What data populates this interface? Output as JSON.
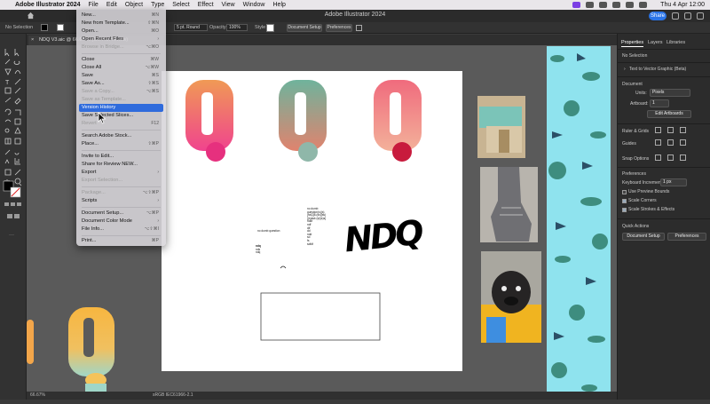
{
  "menubar": {
    "app_name": "Adobe Illustrator 2024",
    "menus": [
      "File",
      "Edit",
      "Object",
      "Type",
      "Select",
      "Effect",
      "View",
      "Window",
      "Help"
    ],
    "datetime": "Thu 4 Apr  12:00"
  },
  "titlebar": {
    "title": "Adobe Illustrator 2024",
    "share_label": "Share"
  },
  "control_bar": {
    "selection": "No Selection",
    "stroke_profile": "5 pt. Round",
    "opacity_label": "Opacity",
    "opacity_value": "100%",
    "style_label": "Style",
    "document_setup": "Document Setup",
    "preferences": "Preferences"
  },
  "document_tab": {
    "name": "NDQ V3.aic @ 66.67 % (CMYK/Preview)"
  },
  "file_menu": {
    "items": [
      {
        "label": "New...",
        "shortcut": "⌘N"
      },
      {
        "label": "New from Template...",
        "shortcut": "⇧⌘N"
      },
      {
        "label": "Open...",
        "shortcut": "⌘O"
      },
      {
        "label": "Open Recent Files",
        "shortcut": "›"
      },
      {
        "label": "Browse in Bridge...",
        "shortcut": "⌥⌘O"
      },
      {
        "label": "Close",
        "shortcut": "⌘W"
      },
      {
        "label": "Close All",
        "shortcut": "⌥⌘W"
      },
      {
        "label": "Save",
        "shortcut": "⌘S"
      },
      {
        "label": "Save As...",
        "shortcut": "⇧⌘S"
      },
      {
        "label": "Save a Copy...",
        "shortcut": "⌥⌘S"
      },
      {
        "label": "Save as Template...",
        "shortcut": ""
      },
      {
        "label": "Version History",
        "shortcut": ""
      },
      {
        "label": "Save Selected Slices...",
        "shortcut": ""
      },
      {
        "label": "Revert",
        "shortcut": "F12"
      },
      {
        "label": "Search Adobe Stock...",
        "shortcut": ""
      },
      {
        "label": "Place...",
        "shortcut": "⇧⌘P"
      },
      {
        "label": "Invite to Edit...",
        "shortcut": ""
      },
      {
        "label": "Share for Review NEW...",
        "shortcut": ""
      },
      {
        "label": "Export",
        "shortcut": "›"
      },
      {
        "label": "Export Selection...",
        "shortcut": ""
      },
      {
        "label": "Package...",
        "shortcut": "⌥⇧⌘P"
      },
      {
        "label": "Scripts",
        "shortcut": "›"
      },
      {
        "label": "Document Setup...",
        "shortcut": "⌥⌘P"
      },
      {
        "label": "Document Color Mode",
        "shortcut": "›"
      },
      {
        "label": "File Info...",
        "shortcut": "⌥⇧⌘I"
      },
      {
        "label": "Print...",
        "shortcut": "⌘P"
      }
    ]
  },
  "artwork": {
    "dumb_question": "no dumb question",
    "paragraph": [
      "no dumb",
      "question(s)(s)",
      "[ndQ]8.(ss)(ss)",
      "[(s)ask (s)i(s)s]",
      "nddf",
      "ndf",
      "dlf",
      "dd",
      "ndd",
      "sd",
      "fs",
      "sdfdf"
    ],
    "ndq_small": [
      "ndq",
      "nds",
      "ndq"
    ],
    "ndq_logo": "NDQ"
  },
  "properties_panel": {
    "tabs": [
      "Properties",
      "Layers",
      "Libraries"
    ],
    "no_selection": "No Selection",
    "text_to_vector": "Text to Vector Graphic (Beta)",
    "document_section": "Document",
    "units_label": "Units:",
    "units_value": "Pixels",
    "artboard_label": "Artboard:",
    "artboard_value": "1",
    "edit_artboards": "Edit Artboards",
    "rulers_grids": "Ruler & Grids",
    "guides": "Guides",
    "snap_options": "Snap Options",
    "preferences_section": "Preferences",
    "keyboard_increment_label": "Keyboard Increment:",
    "keyboard_increment_value": "1 px",
    "use_preview_bounds": "Use Preview Bounds",
    "scale_corners": "Scale Corners",
    "scale_strokes": "Scale Strokes & Effects",
    "quick_actions": "Quick Actions",
    "document_setup_btn": "Document Setup",
    "preferences_btn": "Preferences"
  },
  "status_bar": {
    "zoom": "66.67%",
    "profile": "sRGB IEC61966-2.1"
  },
  "colors": {
    "accent": "#2f6bdc",
    "share": "#2a74e8",
    "pattern_bg": "#8fe3ee"
  }
}
